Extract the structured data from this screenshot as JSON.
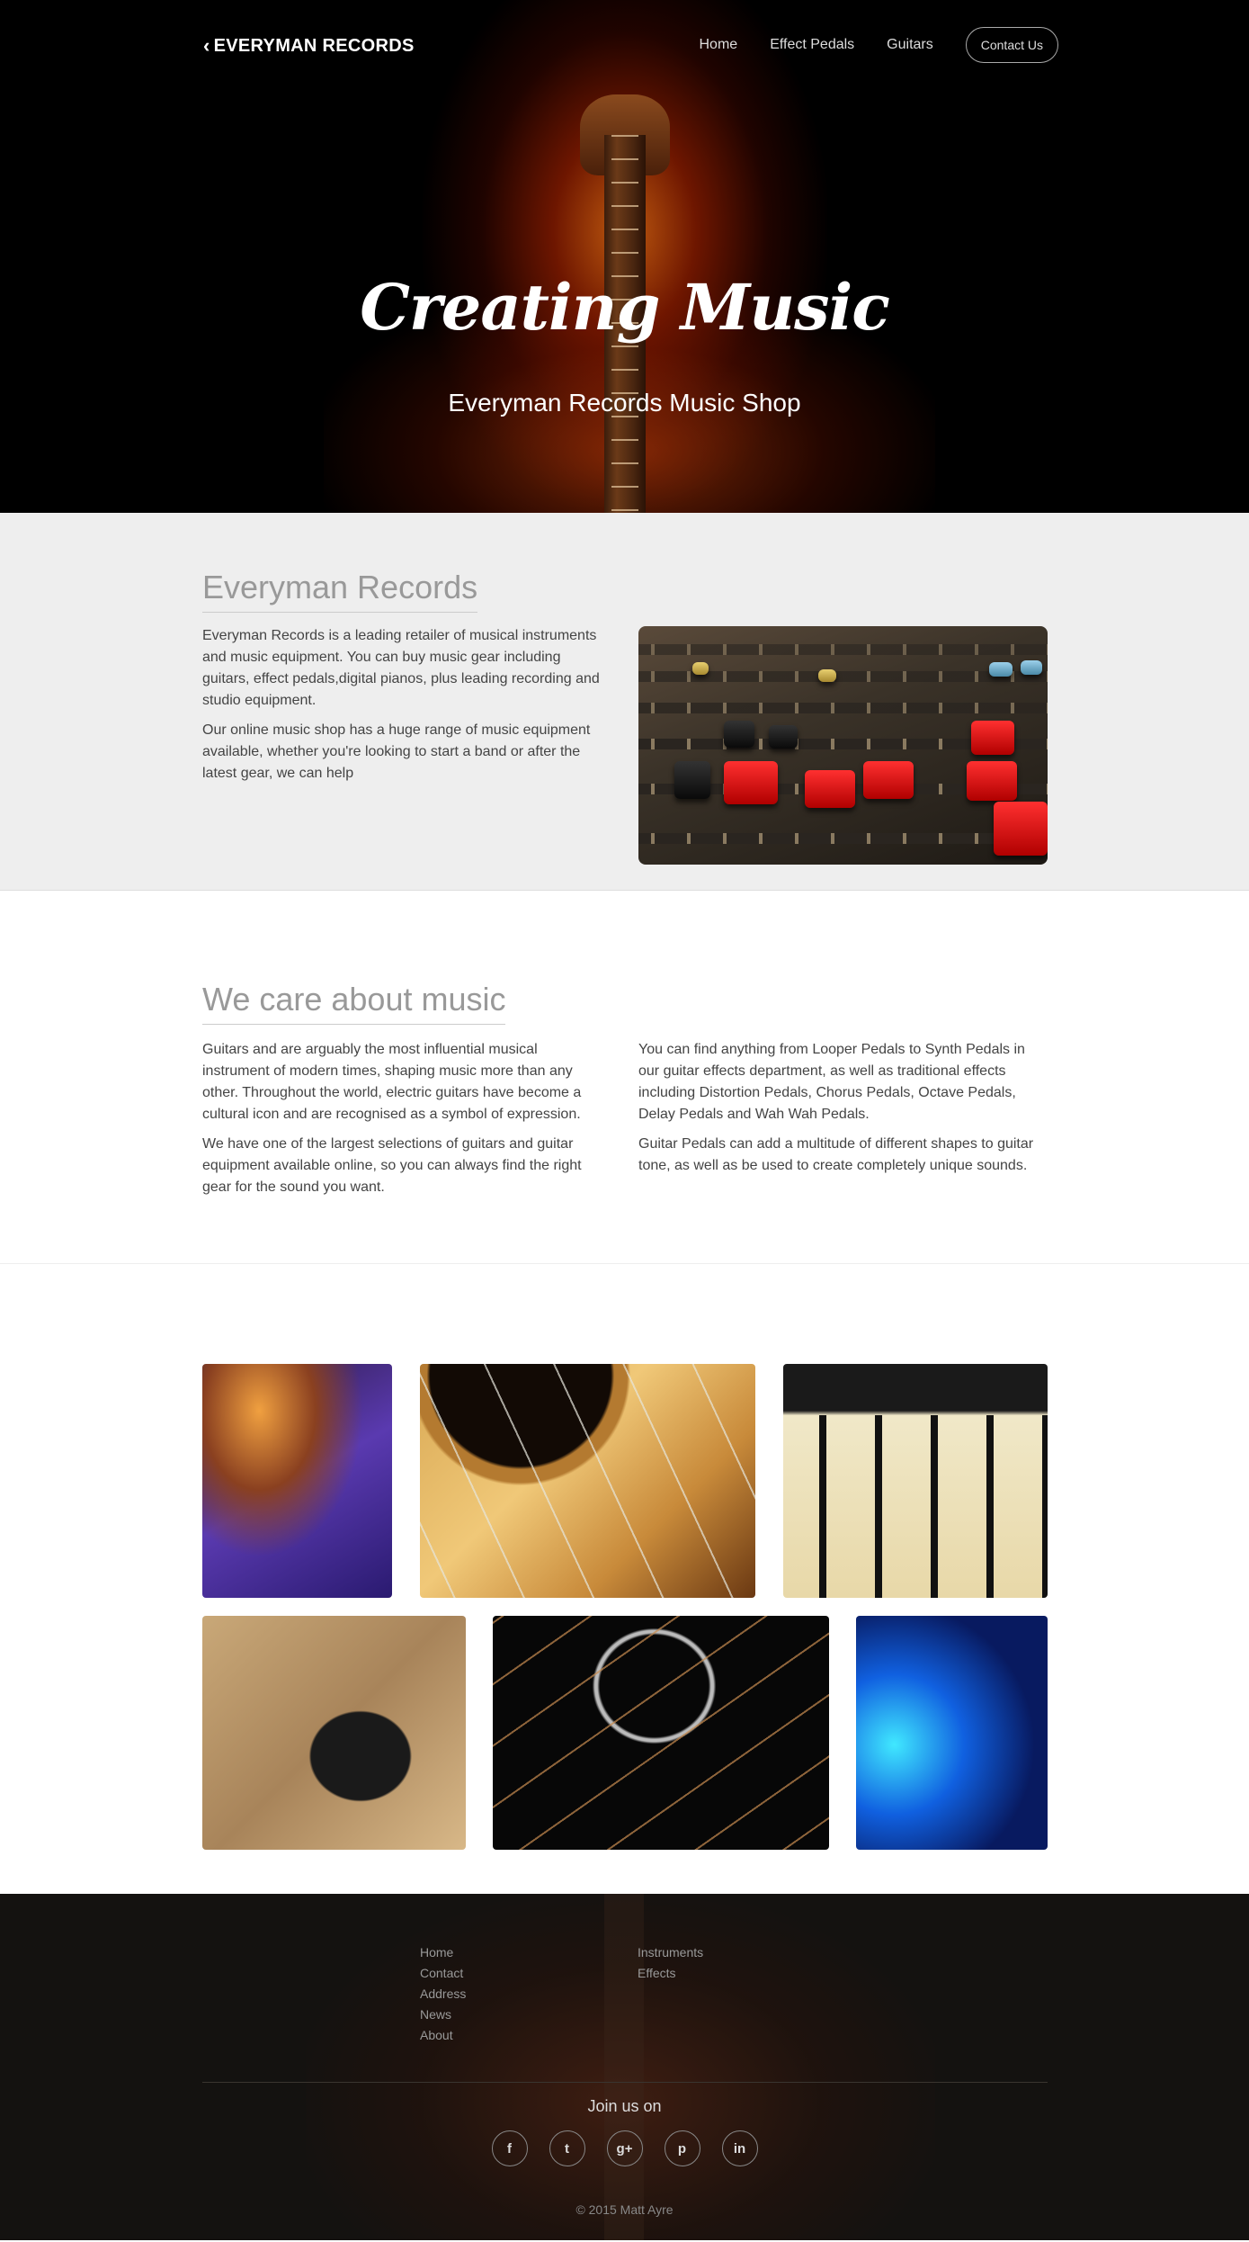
{
  "brand": {
    "name": "EVERYMAN RECORDS"
  },
  "nav": {
    "items": [
      "Home",
      "Effect Pedals",
      "Guitars"
    ],
    "contact": "Contact Us"
  },
  "hero": {
    "title": "Creating Music",
    "subtitle": "Everyman Records Music Shop"
  },
  "about": {
    "title": "Everyman Records",
    "paragraphs": [
      "Everyman Records is a leading retailer of musical instruments and music equipment. You can buy music gear including guitars, effect pedals,digital pianos, plus leading recording and studio equipment.",
      "Our online music shop has a huge range of music equipment available, whether you're looking to start a band or after the latest gear, we can help"
    ]
  },
  "care": {
    "title": "We care about music",
    "left": [
      "Guitars and are arguably the most influential musical instrument of modern times, shaping music more than any other. Throughout the world, electric guitars have become a cultural icon and are recognised as a symbol of expression.",
      "We have one of the largest selections of guitars and guitar equipment available online, so you can always find the right gear for the sound you want."
    ],
    "right": [
      "You can find anything from Looper Pedals to Synth Pedals in our guitar effects department, as well as traditional effects including Distortion Pedals, Chorus Pedals, Octave Pedals, Delay Pedals and Wah Wah Pedals.",
      "Guitar Pedals can add a multitude of different shapes to guitar tone, as well as be used to create completely unique sounds."
    ]
  },
  "footer": {
    "col1": [
      "Home",
      "Contact",
      "Address",
      "News",
      "About"
    ],
    "col2": [
      "Instruments",
      "Effects"
    ],
    "join": "Join us on",
    "socials": [
      {
        "icon": "facebook-icon",
        "glyph": "f"
      },
      {
        "icon": "twitter-icon",
        "glyph": "t"
      },
      {
        "icon": "google-plus-icon",
        "glyph": "g+"
      },
      {
        "icon": "pinterest-icon",
        "glyph": "p"
      },
      {
        "icon": "linkedin-icon",
        "glyph": "in"
      }
    ],
    "copyright": "© 2015 Matt Ayre"
  }
}
